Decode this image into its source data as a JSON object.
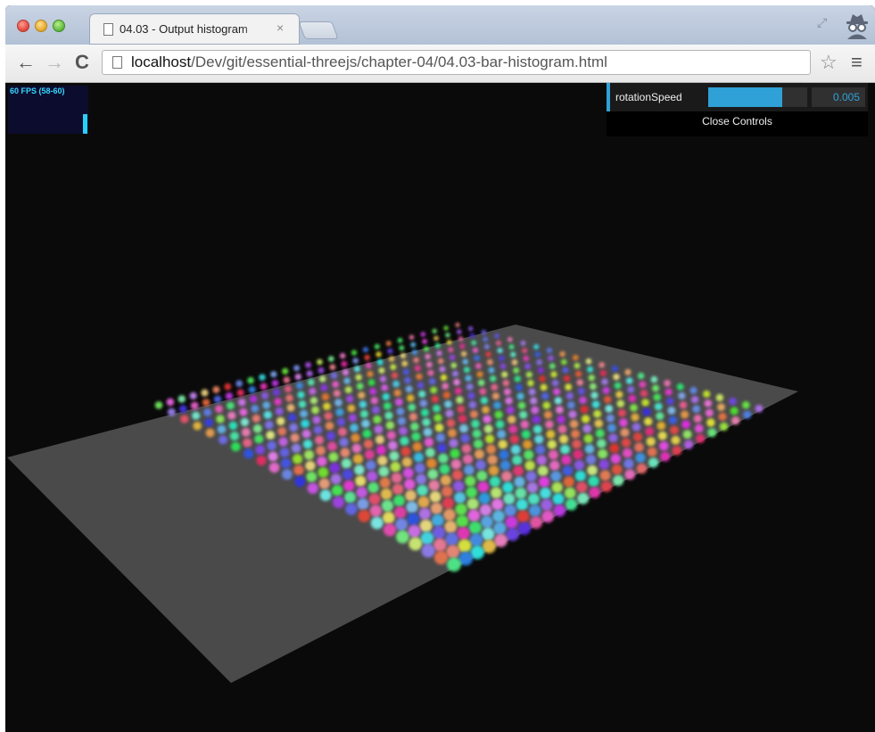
{
  "tab": {
    "title": "04.03 - Output histogram",
    "close_glyph": "×"
  },
  "toolbar": {
    "back_glyph": "←",
    "forward_glyph": "→",
    "reload_glyph": "C",
    "url_host": "localhost",
    "url_path": "/Dev/git/essential-threejs/chapter-04/04.03-bar-histogram.html",
    "star_glyph": "☆",
    "menu_glyph": "≡",
    "fullscreen_glyph": "⤢"
  },
  "stats": {
    "fps_text": "60 FPS (58-60)",
    "fps_level": 1
  },
  "gui": {
    "param_label": "rotationSpeed",
    "param_value": "0.005",
    "slider_fraction": 0.75,
    "close_label": "Close Controls"
  },
  "colors": {
    "accent": "#2fa1d6",
    "plane": "#4a4a4a",
    "background": "#0a0a0a"
  },
  "icons": [
    "doc-icon",
    "fullscreen-icon",
    "incognito-icon",
    "star-icon",
    "menu-icon"
  ]
}
